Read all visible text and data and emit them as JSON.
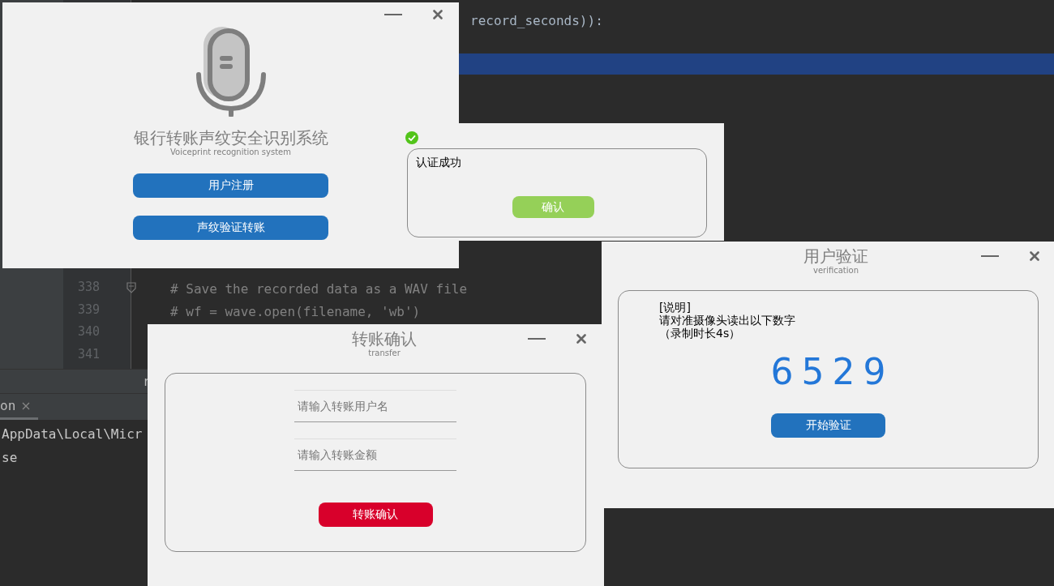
{
  "editor": {
    "code_line_top": "record_seconds)):",
    "line_numbers": [
      "338",
      "339",
      "340",
      "341"
    ],
    "code_lines": [
      "# Save the recorded data as a WAV file",
      "# wf = wave.open(filename, 'wb')"
    ],
    "bottom_bar_text": "r",
    "tool_tabs": [
      {
        "label": "on",
        "selected": true
      }
    ],
    "console_lines": [
      "AppData\\Local\\Micr",
      "se"
    ]
  },
  "main_window": {
    "title": "银行转账声纹安全识别系统",
    "subtitle": "Voiceprint recognition system",
    "buttons": [
      "用户注册",
      "声纹验证转账"
    ]
  },
  "message_box": {
    "message": "认证成功",
    "button": "确认"
  },
  "verify_window": {
    "title": "用户验证",
    "subtitle": "verification",
    "instructions": [
      "[说明]",
      "请对准摄像头读出以下数字",
      "（录制时长4s）"
    ],
    "code": "6 5 2 9",
    "button": "开始验证"
  },
  "transfer_window": {
    "title": "转账确认",
    "subtitle": "transfer",
    "fields": [
      {
        "placeholder": "请输入转账用户名"
      },
      {
        "placeholder": "请输入转账金额"
      }
    ],
    "button": "转账确认"
  }
}
